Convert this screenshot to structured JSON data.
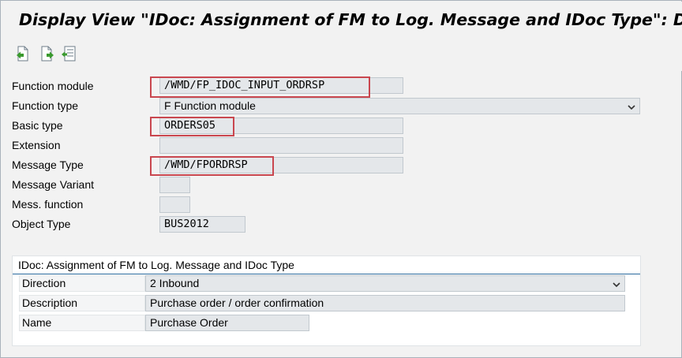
{
  "window": {
    "title": "Display View \"IDoc: Assignment of FM to Log. Message and IDoc Type\": D"
  },
  "toolbar": {
    "icons": [
      "previous-entry-icon",
      "next-entry-icon",
      "variable-list-icon"
    ]
  },
  "form": {
    "function_module_label": "Function module",
    "function_module_value": "/WMD/FP_IDOC_INPUT_ORDRSP",
    "function_type_label": "Function type",
    "function_type_value": "F Function module",
    "basic_type_label": "Basic type",
    "basic_type_value": "ORDERS05",
    "extension_label": "Extension",
    "extension_value": "",
    "message_type_label": "Message Type",
    "message_type_value": "/WMD/FPORDRSP",
    "message_variant_label": "Message Variant",
    "message_variant_value": "",
    "mess_function_label": "Mess. function",
    "mess_function_value": "",
    "object_type_label": "Object Type",
    "object_type_value": "BUS2012"
  },
  "group": {
    "title": "IDoc: Assignment of FM to Log. Message and IDoc Type",
    "direction_label": "Direction",
    "direction_value": "2 Inbound",
    "description_label": "Description",
    "description_value": "Purchase order / order confirmation",
    "name_label": "Name",
    "name_value": "Purchase Order"
  },
  "colors": {
    "highlight": "#c9474f",
    "field_bg": "#e4e7ea",
    "group_rule": "#2b6a9d"
  }
}
